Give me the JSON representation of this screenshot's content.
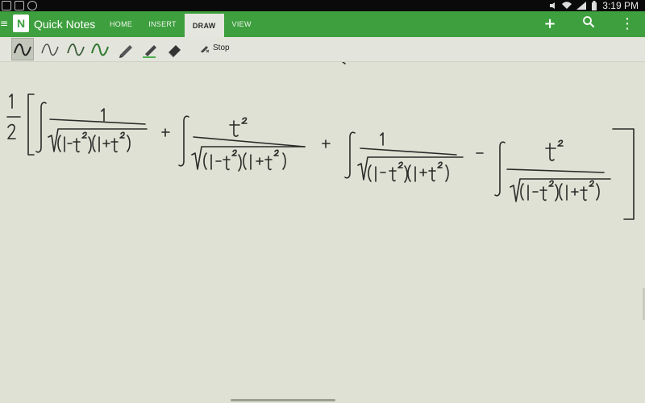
{
  "status_bar": {
    "time": "3:19 PM",
    "icons": [
      "app-notification-icon",
      "sync-icon",
      "browser-icon",
      "mute-icon",
      "wifi-icon",
      "signal-icon",
      "battery-icon"
    ]
  },
  "app_bar": {
    "title": "Quick Notes",
    "logo_letter": "N",
    "menu_glyph": "≡",
    "tabs": [
      {
        "label": "HOME",
        "active": false
      },
      {
        "label": "INSERT",
        "active": false
      },
      {
        "label": "DRAW",
        "active": true
      },
      {
        "label": "VIEW",
        "active": false
      }
    ],
    "actions": {
      "add": "+",
      "search": "⌕",
      "more": "⋮"
    },
    "colors": {
      "bar": "#3e9f3e",
      "active_tab_bg": "#e6e6e0"
    }
  },
  "toolbar": {
    "tools": [
      "pen-black",
      "pen-black-thin",
      "pen-dark-green",
      "pen-green",
      "pencil",
      "highlighter-green",
      "eraser"
    ],
    "selected_tool": "pen-black",
    "stop_label": "Stop"
  }
}
